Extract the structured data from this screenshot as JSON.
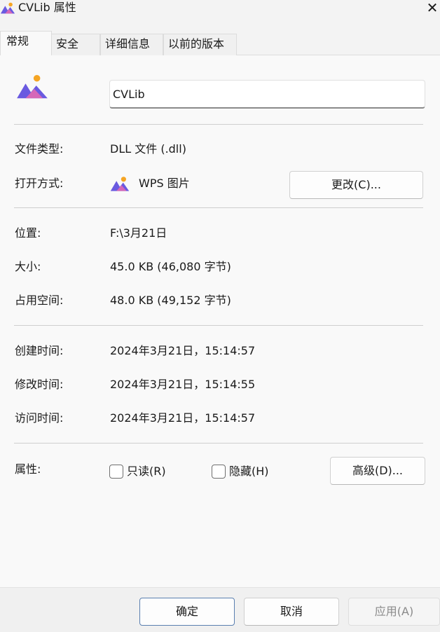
{
  "window": {
    "title": "CVLib 属性",
    "close_glyph": "✕"
  },
  "tabs": [
    {
      "label": "常规",
      "active": true
    },
    {
      "label": "安全",
      "active": false
    },
    {
      "label": "详细信息",
      "active": false
    },
    {
      "label": "以前的版本",
      "active": false
    }
  ],
  "general": {
    "file_name": "CVLib",
    "file_type_label": "文件类型:",
    "file_type_value": "DLL 文件 (.dll)",
    "opens_with_label": "打开方式:",
    "opens_with_value": "WPS 图片",
    "change_button": "更改(C)...",
    "location_label": "位置:",
    "location_value": "F:\\3月21日",
    "size_label": "大小:",
    "size_value": "45.0 KB (46,080 字节)",
    "size_on_disk_label": "占用空间:",
    "size_on_disk_value": "48.0 KB (49,152 字节)",
    "created_label": "创建时间:",
    "created_value": "2024年3月21日，15:14:57",
    "modified_label": "修改时间:",
    "modified_value": "2024年3月21日，15:14:55",
    "accessed_label": "访问时间:",
    "accessed_value": "2024年3月21日，15:14:57",
    "attributes_label": "属性:",
    "readonly_label": "只读(R)",
    "readonly_checked": false,
    "hidden_label": "隐藏(H)",
    "hidden_checked": false,
    "advanced_button": "高级(D)..."
  },
  "footer": {
    "ok_button": "确定",
    "cancel_button": "取消",
    "apply_button": "应用(A)"
  },
  "icons": {
    "app_icon": "wps-image-icon",
    "close_icon": "close-icon"
  },
  "colors": {
    "icon_purple": "#6a5ae0",
    "icon_pink": "#e86bb0",
    "icon_orange": "#f5a524",
    "primary_border": "#5a7fb0"
  }
}
